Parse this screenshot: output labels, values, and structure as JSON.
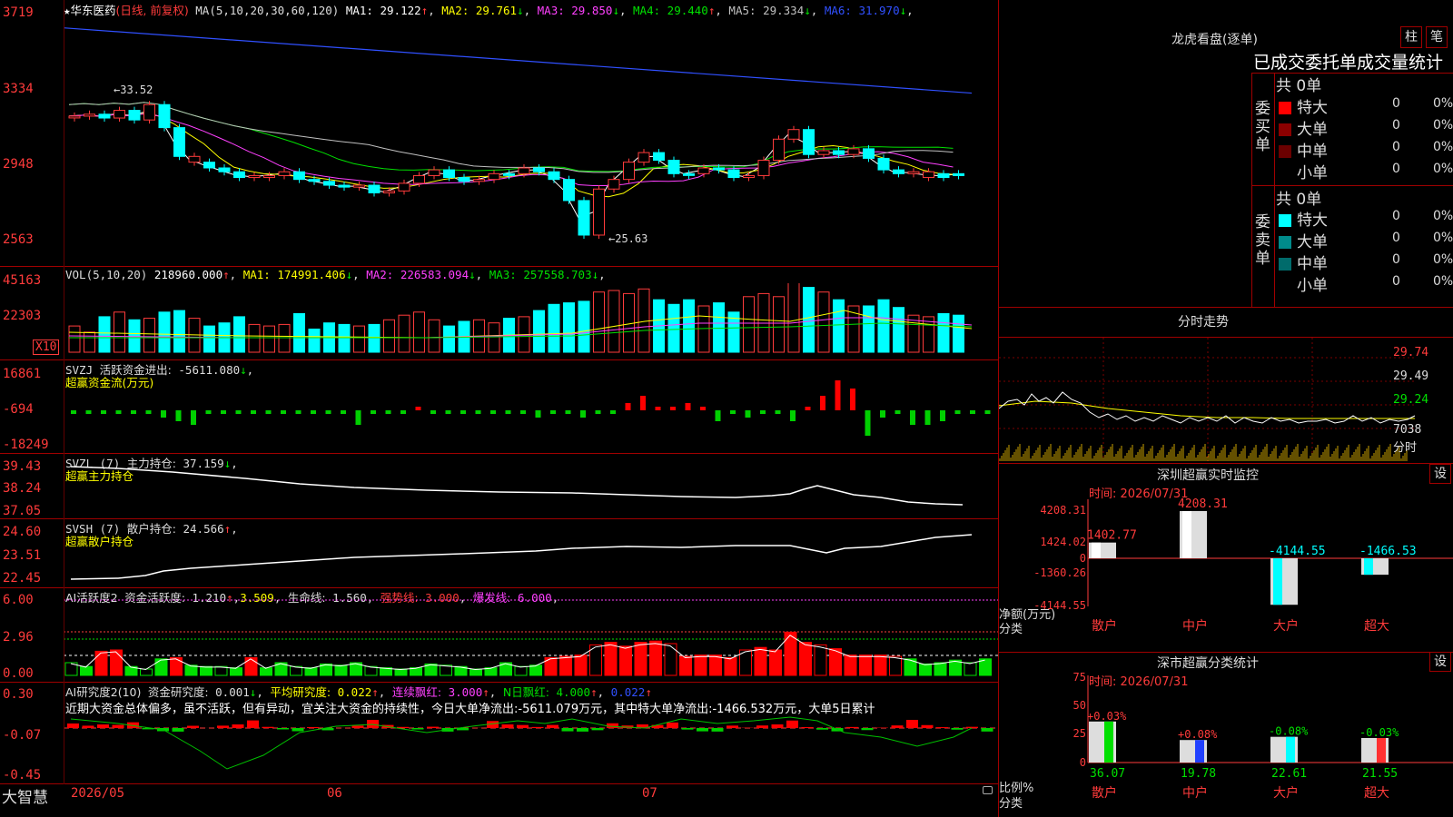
{
  "stock": {
    "star": "★",
    "name": "华东医药",
    "mode": "(日线, 前复权)"
  },
  "kline": {
    "ma_params": "MA(5,10,20,30,60,120)",
    "ma": [
      {
        "label": "MA1:",
        "value": "29.122",
        "arrow": "↑",
        "color": "#ffffff"
      },
      {
        "label": "MA2:",
        "value": "29.761",
        "arrow": "↓",
        "color": "#ffff00"
      },
      {
        "label": "MA3:",
        "value": "29.850",
        "arrow": "↓",
        "color": "#ff40ff"
      },
      {
        "label": "MA4:",
        "value": "29.440",
        "arrow": "↑",
        "color": "#00e000"
      },
      {
        "label": "MA5:",
        "value": "29.334",
        "arrow": "↓",
        "color": "#c0c0c0"
      },
      {
        "label": "MA6:",
        "value": "31.970",
        "arrow": "↓",
        "color": "#3050ff"
      }
    ],
    "yticks": [
      "3719",
      "3334",
      "2948",
      "2563"
    ],
    "high_mark": "←33.52",
    "low_mark": "←25.63",
    "prices": [
      32.3,
      32.4,
      32.2,
      32.6,
      32.1,
      32.9,
      31.7,
      30.2,
      29.9,
      29.6,
      29.4,
      29.1,
      29.2,
      29.2,
      29.4,
      29.0,
      28.9,
      28.7,
      28.6,
      28.7,
      28.3,
      28.4,
      28.8,
      29.2,
      29.5,
      29.1,
      28.9,
      29.0,
      29.3,
      29.3,
      29.6,
      29.4,
      29.0,
      27.9,
      26.1,
      28.5,
      29.0,
      29.9,
      30.4,
      30.0,
      29.3,
      29.3,
      29.6,
      29.5,
      29.1,
      29.2,
      30.0,
      31.1,
      31.6,
      30.3,
      30.5,
      30.3,
      30.6,
      30.1,
      29.5,
      29.3,
      29.4,
      29.1,
      29.3,
      29.2
    ],
    "up_flags": [
      1,
      1,
      0,
      1,
      0,
      1,
      0,
      0,
      1,
      0,
      0,
      0,
      1,
      1,
      1,
      0,
      0,
      0,
      0,
      1,
      0,
      1,
      1,
      1,
      1,
      0,
      0,
      1,
      1,
      0,
      1,
      0,
      0,
      0,
      0,
      1,
      1,
      1,
      1,
      0,
      0,
      0,
      1,
      0,
      0,
      1,
      1,
      1,
      1,
      0,
      1,
      0,
      1,
      0,
      0,
      0,
      1,
      1,
      0,
      0
    ]
  },
  "vol": {
    "params": "VOL(5,10,20)",
    "value": "218960.000",
    "value_arrow": "↑",
    "ma": [
      {
        "label": "MA1:",
        "value": "174991.406",
        "arrow": "↓",
        "color": "#ffff00"
      },
      {
        "label": "MA2:",
        "value": "226583.094",
        "arrow": "↓",
        "color": "#ff40ff"
      },
      {
        "label": "MA3:",
        "value": "257558.703",
        "arrow": "↓",
        "color": "#00e000"
      }
    ],
    "yticks": [
      "45163",
      "22303"
    ],
    "unit": "X10",
    "values": [
      1.7,
      1.3,
      2.3,
      2.6,
      2.1,
      2.2,
      2.6,
      2.7,
      2.2,
      1.7,
      1.9,
      2.3,
      1.8,
      1.7,
      1.8,
      2.5,
      1.5,
      1.9,
      1.8,
      1.7,
      1.8,
      2.1,
      2.4,
      2.6,
      2.1,
      1.7,
      2.0,
      2.1,
      1.9,
      2.2,
      2.3,
      2.7,
      3.1,
      3.2,
      3.3,
      3.9,
      4.0,
      3.8,
      4.1,
      3.4,
      3.1,
      3.4,
      3.0,
      3.2,
      2.6,
      3.6,
      3.8,
      3.6,
      4.7,
      4.2,
      3.9,
      3.4,
      3.0,
      3.0,
      3.4,
      2.9,
      2.4,
      2.3,
      2.5,
      2.4
    ]
  },
  "svzj": {
    "name": "SVZJ",
    "label": "活跃资金进出:",
    "value": "-5611.080",
    "arrow": "↓",
    "sub": "超赢资金流(万元)",
    "yticks": [
      "16861",
      "-694",
      "-18249"
    ],
    "values": [
      -1,
      -1,
      -1,
      -1,
      -1,
      -1,
      -2,
      -3,
      -4,
      -1,
      -1,
      -1,
      -1,
      -1,
      -1,
      -1,
      -1,
      -1,
      -1,
      -4,
      -1,
      -1,
      -1,
      1,
      -1,
      -1,
      -1,
      -1,
      -1,
      -1,
      -1,
      -2,
      -1,
      -1,
      -2,
      -1,
      -1,
      2,
      4,
      1,
      1,
      2,
      1,
      -3,
      -1,
      -2,
      -1,
      -1,
      -3,
      1,
      4,
      9,
      6,
      -7,
      -2,
      -1,
      -4,
      -4,
      -3,
      -1,
      -1,
      -1,
      -3
    ]
  },
  "svzl": {
    "name": "SVZL",
    "params": "(7)",
    "label": "主力持仓:",
    "value": "37.159",
    "arrow": "↓",
    "sub": "超赢主力持仓",
    "yticks": [
      "39.43",
      "38.24",
      "37.05"
    ]
  },
  "svsh": {
    "name": "SVSH",
    "params": "(7)",
    "label": "散户持仓:",
    "value": "24.566",
    "arrow": "↑",
    "sub": "超赢散户持仓",
    "yticks": [
      "24.60",
      "23.51",
      "22.45"
    ]
  },
  "ai1": {
    "name": "AI活跃度2",
    "label": "资金活跃度:",
    "value": "1.210",
    "arrow": "↑",
    "value2": "3.509",
    "life_label": "生命线:",
    "life_value": "1.560",
    "strong_label": "强势线:",
    "strong_value": "3.000",
    "burst_label": "爆发线:",
    "burst_value": "6.000",
    "yticks": [
      "6.00",
      "2.96",
      "0.00"
    ],
    "values": [
      1.0,
      0.7,
      1.9,
      2.0,
      0.7,
      0.5,
      1.3,
      1.4,
      0.8,
      0.7,
      0.7,
      0.6,
      1.4,
      0.6,
      1.0,
      0.7,
      0.6,
      0.9,
      0.8,
      1.0,
      0.7,
      0.6,
      0.5,
      0.6,
      0.9,
      0.8,
      0.7,
      0.5,
      0.6,
      1.0,
      0.7,
      0.8,
      1.4,
      1.5,
      1.6,
      2.4,
      2.6,
      2.3,
      2.6,
      2.7,
      2.5,
      1.5,
      1.6,
      1.6,
      1.4,
      2.0,
      2.2,
      2.0,
      3.4,
      2.6,
      2.4,
      2.1,
      1.6,
      1.6,
      1.6,
      1.5,
      1.3,
      0.9,
      1.0,
      1.2,
      1.0,
      1.3
    ]
  },
  "ai2": {
    "name": "AI研究度2(10)",
    "label": "资金研究度:",
    "value": "0.001",
    "arrow": "↓",
    "avg_label": "平均研究度:",
    "avg_value": "0.022",
    "avg_arrow": "↑",
    "cont_label": "连续飘红:",
    "cont_value": "3.000",
    "cont_arrow": "↑",
    "n_label": "N日飘红:",
    "n_value": "4.000",
    "n_arrow": "↑",
    "last_value": "0.022",
    "last_arrow": "↑",
    "comment": "近期大资金总体偏多，虽不活跃，但有异动，宜关注大资金的持续性，今日大单净流出:-5611.079万元，其中特大单净流出:-1466.532万元，大单5日累计",
    "yticks": [
      "0.30",
      "-0.07",
      "-0.45"
    ]
  },
  "timeaxis": {
    "brand": "大智慧",
    "labels": [
      "2026/05",
      "06",
      "07"
    ]
  },
  "lhb": {
    "title": "龙虎看盘(逐单)",
    "btn_zhu": "柱",
    "btn_bi": "笔",
    "subtitle": "已成交委托单成交量统计",
    "buy_side": "委买单",
    "sell_side": "委卖单",
    "buy_total": "共 0单",
    "sell_total": "共 0单",
    "buy_rows": [
      {
        "name": "特大",
        "count": "0",
        "pct": "0%",
        "color": "#ff0000"
      },
      {
        "name": "大单",
        "count": "0",
        "pct": "0%",
        "color": "#8b0000"
      },
      {
        "name": "中单",
        "count": "0",
        "pct": "0%",
        "color": "#6b0000"
      },
      {
        "name": "小单",
        "count": "0",
        "pct": "0%",
        "color": ""
      }
    ],
    "sell_rows": [
      {
        "name": "特大",
        "count": "0",
        "pct": "0%",
        "color": "#00ffff"
      },
      {
        "name": "大单",
        "count": "0",
        "pct": "0%",
        "color": "#008b8b"
      },
      {
        "name": "中单",
        "count": "0",
        "pct": "0%",
        "color": "#006b6b"
      },
      {
        "name": "小单",
        "count": "0",
        "pct": "0%",
        "color": ""
      }
    ]
  },
  "intraday": {
    "title": "分时走势",
    "prices": [
      "29.74",
      "29.49",
      "29.24"
    ],
    "vol": "7038",
    "unit": "分时"
  },
  "sz_monitor": {
    "title": "深圳超赢实时监控",
    "btn": "设",
    "time_label": "时间:",
    "time": "2026/07/31",
    "yticks": [
      "4208.31",
      "1424.02",
      "0",
      "-1360.26",
      "-4144.55"
    ],
    "bars": [
      {
        "cat": "散户",
        "value": 1402.77,
        "label": "1402.77"
      },
      {
        "cat": "中户",
        "value": 4208.31,
        "label": "4208.31"
      },
      {
        "cat": "大户",
        "value": -4144.55,
        "label": "-4144.55"
      },
      {
        "cat": "超大",
        "value": -1466.53,
        "label": "-1466.53"
      }
    ],
    "ylabel": "净额(万元)",
    "xlabel": "分类"
  },
  "sz_class": {
    "title": "深市超赢分类统计",
    "btn": "设",
    "time_label": "时间:",
    "time": "2026/07/31",
    "yticks": [
      "75",
      "50",
      "25",
      "0"
    ],
    "bars": [
      {
        "cat": "散户",
        "value": 36.07,
        "change": "+0.03%",
        "label": "36.07"
      },
      {
        "cat": "中户",
        "value": 19.78,
        "change": "+0.08%",
        "label": "19.78"
      },
      {
        "cat": "大户",
        "value": 22.61,
        "change": "-0.08%",
        "label": "22.61"
      },
      {
        "cat": "超大",
        "value": 21.55,
        "change": "-0.03%",
        "label": "21.55"
      }
    ],
    "ylabel": "比例%",
    "xlabel": "分类"
  }
}
